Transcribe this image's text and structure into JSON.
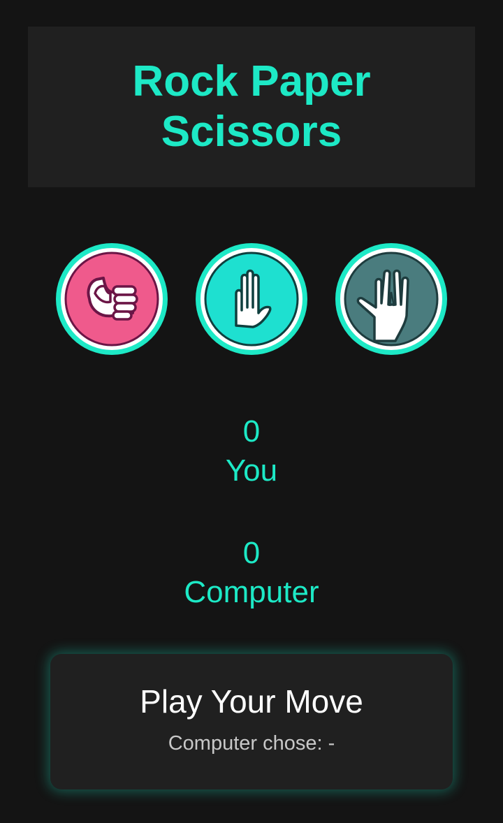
{
  "header": {
    "title": "Rock Paper Scissors"
  },
  "choices": [
    {
      "name": "rock",
      "icon": "fist-icon",
      "color": "#ef5a8c"
    },
    {
      "name": "paper",
      "icon": "open-hand-icon",
      "color": "#1ee0d0"
    },
    {
      "name": "scissors",
      "icon": "vulcan-salute-icon",
      "color": "#4a7c7e"
    }
  ],
  "scores": {
    "you": {
      "value": "0",
      "label": "You"
    },
    "computer": {
      "value": "0",
      "label": "Computer"
    }
  },
  "panel": {
    "title": "Play Your Move",
    "status": "Computer chose: -"
  },
  "colors": {
    "accent": "#1de9c6",
    "background": "#141414",
    "card": "#202020"
  }
}
